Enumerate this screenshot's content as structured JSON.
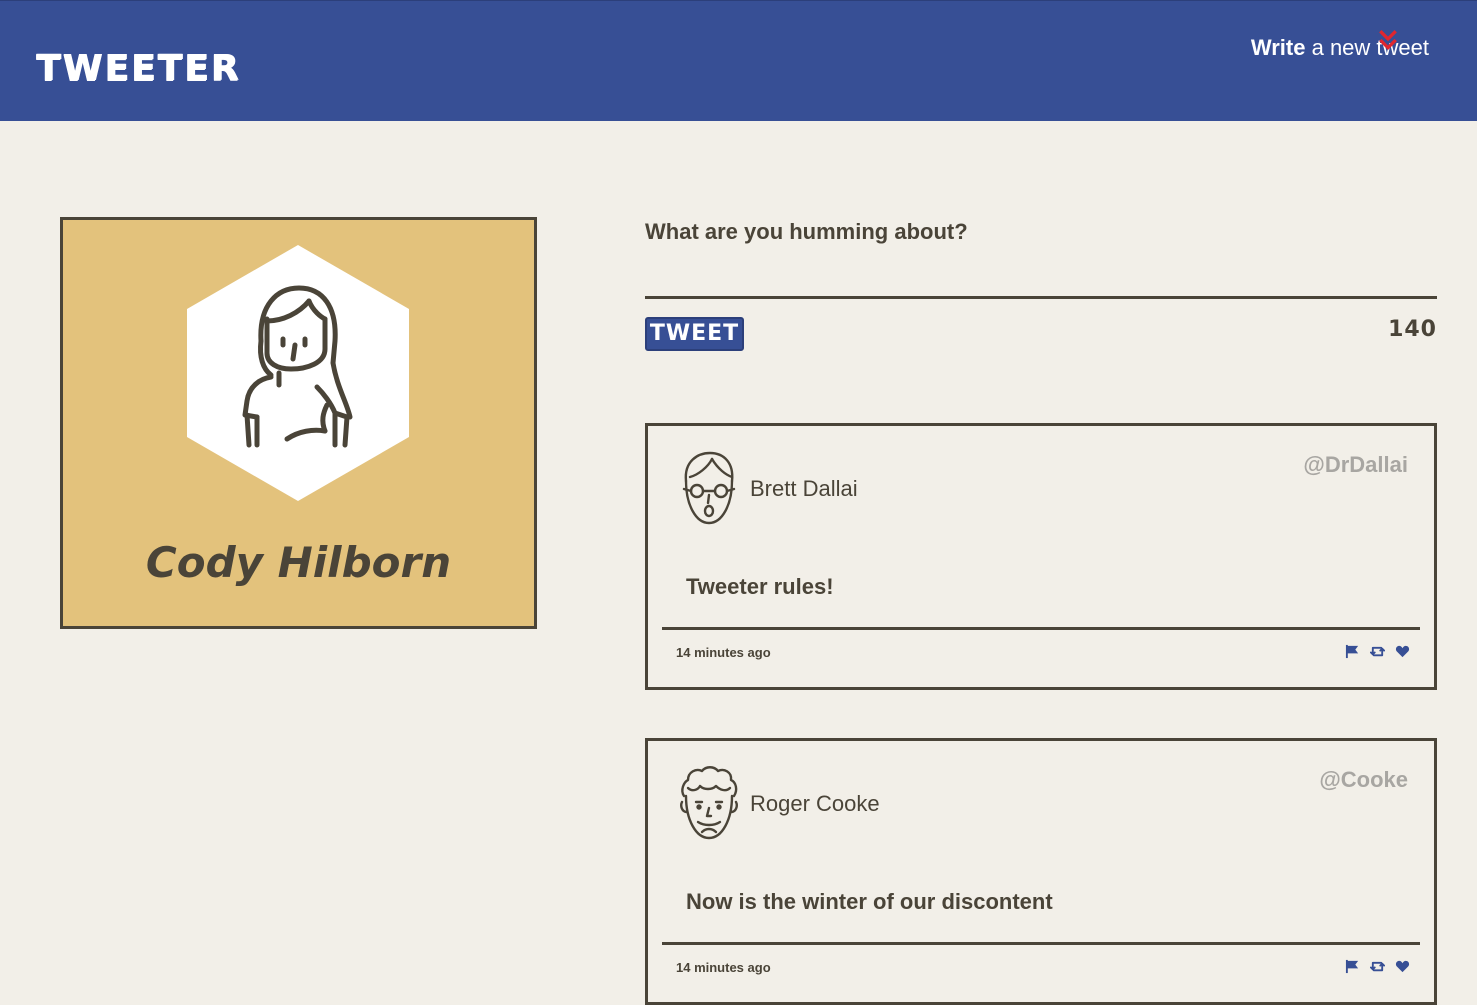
{
  "header": {
    "logo": "TWEETER",
    "compose_toggle_strong": "Write",
    "compose_toggle_rest": " a new tweet",
    "compose_toggle_icon": "double-chevron-down-icon",
    "accent_color": "#e0262f",
    "brand_color": "#374f95"
  },
  "profile": {
    "name": "Cody Hilborn",
    "avatar_icon": "female-avatar-icon",
    "card_color": "#e3c27c"
  },
  "compose": {
    "prompt": "What are you humming about?",
    "input_value": "",
    "button_label": "TWEET",
    "counter": "140"
  },
  "tweets": [
    {
      "author": "Brett Dallai",
      "handle": "@DrDallai",
      "content": "Tweeter rules!",
      "time": "14 minutes ago",
      "avatar_icon": "glasses-avatar-icon"
    },
    {
      "author": "Roger Cooke",
      "handle": "@Cooke",
      "content": "Now is the winter of our discontent",
      "time": "14 minutes ago",
      "avatar_icon": "curly-hair-avatar-icon"
    }
  ],
  "actions": {
    "flag_icon": "flag-icon",
    "retweet_icon": "retweet-icon",
    "like_icon": "heart-icon"
  }
}
